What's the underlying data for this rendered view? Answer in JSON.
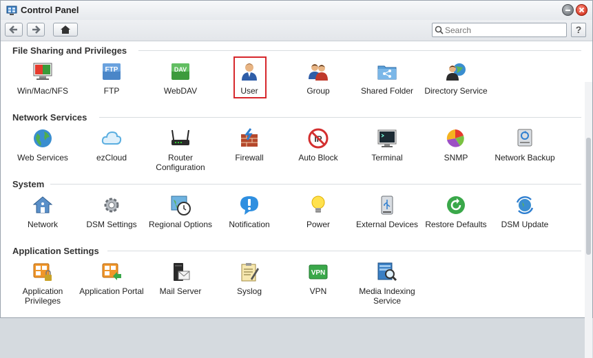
{
  "window": {
    "title": "Control Panel",
    "app_icon": "control-panel-icon",
    "buttons": [
      "minimize-icon",
      "close-icon"
    ]
  },
  "toolbar": {
    "back_icon": "arrow-left-icon",
    "forward_icon": "arrow-right-icon",
    "home_icon": "home-icon",
    "search_placeholder": "Search",
    "help_label": "?"
  },
  "sections": [
    {
      "title": "File Sharing and Privileges",
      "items": [
        {
          "label": "Win/Mac/NFS",
          "icon": "win-mac-nfs-icon"
        },
        {
          "label": "FTP",
          "icon": "ftp-icon"
        },
        {
          "label": "WebDAV",
          "icon": "webdav-icon"
        },
        {
          "label": "User",
          "icon": "user-icon",
          "selected": true
        },
        {
          "label": "Group",
          "icon": "group-icon"
        },
        {
          "label": "Shared Folder",
          "icon": "shared-folder-icon"
        },
        {
          "label": "Directory Service",
          "icon": "directory-service-icon"
        }
      ]
    },
    {
      "title": "Network Services",
      "items": [
        {
          "label": "Web Services",
          "icon": "globe-icon"
        },
        {
          "label": "ezCloud",
          "icon": "cloud-icon"
        },
        {
          "label": "Router Configuration",
          "icon": "router-icon"
        },
        {
          "label": "Firewall",
          "icon": "firewall-icon"
        },
        {
          "label": "Auto Block",
          "icon": "auto-block-icon"
        },
        {
          "label": "Terminal",
          "icon": "terminal-icon"
        },
        {
          "label": "SNMP",
          "icon": "snmp-icon"
        },
        {
          "label": "Network Backup",
          "icon": "network-backup-icon"
        }
      ]
    },
    {
      "title": "System",
      "items": [
        {
          "label": "Network",
          "icon": "network-home-icon"
        },
        {
          "label": "DSM Settings",
          "icon": "gear-icon"
        },
        {
          "label": "Regional Options",
          "icon": "regional-clock-icon"
        },
        {
          "label": "Notification",
          "icon": "notification-icon"
        },
        {
          "label": "Power",
          "icon": "lightbulb-icon"
        },
        {
          "label": "External Devices",
          "icon": "usb-device-icon"
        },
        {
          "label": "Restore Defaults",
          "icon": "restore-icon"
        },
        {
          "label": "DSM Update",
          "icon": "update-icon"
        }
      ]
    },
    {
      "title": "Application Settings",
      "items": [
        {
          "label": "Application Privileges",
          "icon": "app-privileges-icon"
        },
        {
          "label": "Application Portal",
          "icon": "app-portal-icon"
        },
        {
          "label": "Mail Server",
          "icon": "mail-server-icon"
        },
        {
          "label": "Syslog",
          "icon": "syslog-icon"
        },
        {
          "label": "VPN",
          "icon": "vpn-icon"
        },
        {
          "label": "Media Indexing Service",
          "icon": "media-indexing-icon"
        }
      ]
    }
  ]
}
